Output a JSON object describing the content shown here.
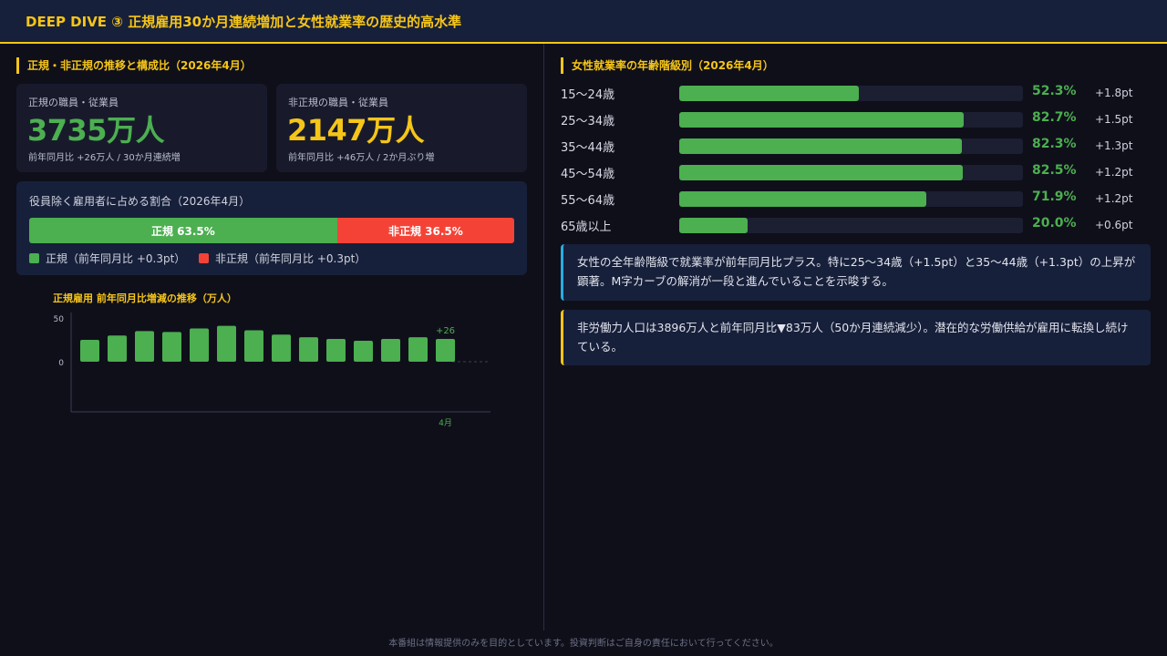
{
  "header": {
    "title": "DEEP DIVE ③ 正規雇用30か月連続増加と女性就業率の歴史的高水準"
  },
  "left": {
    "section_title": "正規・非正規の推移と構成比（2026年4月）",
    "regular": {
      "label": "正規の職員・従業員",
      "value": "3735万人",
      "sub": "前年同月比 +26万人 / 30か月連続増",
      "color": "#4caf50"
    },
    "nonregular": {
      "label": "非正規の職員・従業員",
      "value": "2147万人",
      "sub": "前年同月比 +46万人 / 2か月ぶり増",
      "color": "#f5c518"
    },
    "ratio": {
      "title": "役員除く雇用者に占める割合（2026年4月）",
      "regular_share": 63.5,
      "nonregular_share": 36.5,
      "regular_label": "正規 63.5%",
      "nonregular_label": "非正規 36.5%",
      "legend_regular": "正規（前年同月比 +0.3pt）",
      "legend_nonregular": "非正規（前年同月比 +0.3pt）",
      "regular_color": "#4caf50",
      "nonregular_color": "#f44336"
    }
  },
  "chart_data": {
    "type": "bar",
    "title": "正規雇用 前年同月比増減の推移（万人）",
    "categories": [
      "",
      "",
      "",
      "",
      "",
      "",
      "",
      "",
      "",
      "",
      "",
      "",
      "",
      "4月"
    ],
    "values": [
      25,
      30,
      35,
      34,
      38,
      41,
      36,
      31,
      28,
      26,
      24,
      26,
      28,
      26
    ],
    "yticks": [
      0,
      50
    ],
    "ylim": [
      -60,
      60
    ],
    "grid": false,
    "legend": "none",
    "value_labels": [
      "",
      "",
      "",
      "",
      "",
      "",
      "",
      "",
      "",
      "",
      "",
      "",
      "",
      "+26"
    ],
    "bar_color": "#4caf50"
  },
  "right": {
    "section_title": "女性就業率の年齢階級別（2026年4月）",
    "age_groups": [
      {
        "label": "15〜24歳",
        "rate": 52.3,
        "value": "52.3%",
        "change": "+1.8pt"
      },
      {
        "label": "25〜34歳",
        "rate": 82.7,
        "value": "82.7%",
        "change": "+1.5pt"
      },
      {
        "label": "35〜44歳",
        "rate": 82.3,
        "value": "82.3%",
        "change": "+1.3pt"
      },
      {
        "label": "45〜54歳",
        "rate": 82.5,
        "value": "82.5%",
        "change": "+1.2pt"
      },
      {
        "label": "55〜64歳",
        "rate": 71.9,
        "value": "71.9%",
        "change": "+1.2pt"
      },
      {
        "label": "65歳以上",
        "rate": 20.0,
        "value": "20.0%",
        "change": "+0.6pt"
      }
    ],
    "bar_color": "#4caf50",
    "note1": "女性の全年齢階級で就業率が前年同月比プラス。特に25〜34歳（+1.5pt）と35〜44歳（+1.3pt）の上昇が顕著。M字カーブの解消が一段と進んでいることを示唆する。",
    "note2": "非労働力人口は3896万人と前年同月比▼83万人（50か月連続減少）。潜在的な労働供給が雇用に転換し続けている。"
  },
  "footer": {
    "disclaimer": "本番組は情報提供のみを目的としています。投資判断はご自身の責任において行ってください。"
  }
}
